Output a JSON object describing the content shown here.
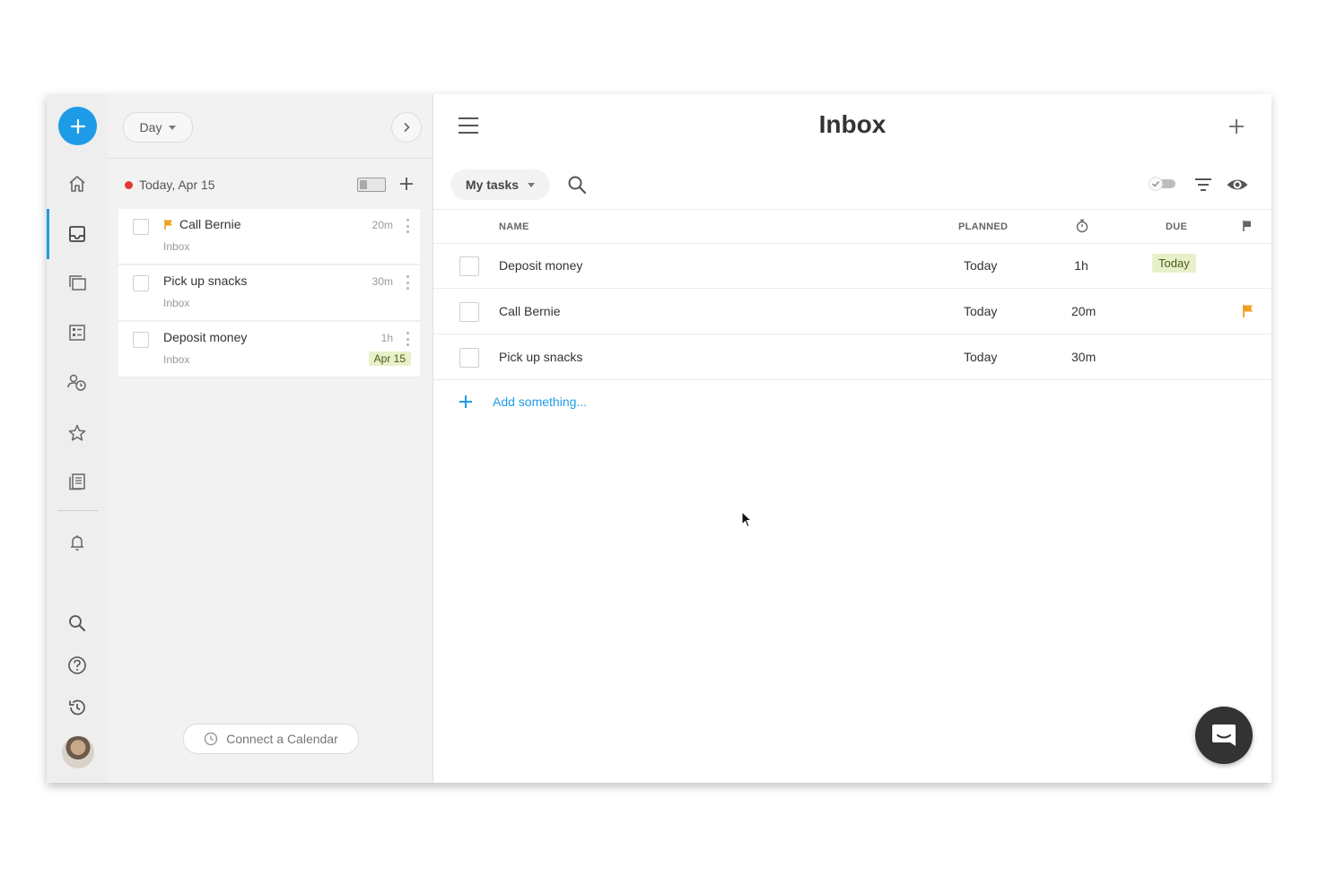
{
  "app": {
    "brand_color": "#1e9be6"
  },
  "rail": {
    "items": [
      {
        "name": "home-icon"
      },
      {
        "name": "inbox-icon",
        "active": true
      },
      {
        "name": "projects-icon"
      },
      {
        "name": "checklist-icon"
      },
      {
        "name": "people-icon"
      },
      {
        "name": "star-icon"
      },
      {
        "name": "notes-icon"
      },
      {
        "name": "bell-icon"
      },
      {
        "name": "search-icon"
      },
      {
        "name": "help-icon"
      },
      {
        "name": "history-icon"
      }
    ]
  },
  "day_panel": {
    "view_selector": "Day",
    "date_label": "Today, Apr 15",
    "tasks": [
      {
        "title": "Call Bernie",
        "list": "Inbox",
        "duration": "20m",
        "flagged": true
      },
      {
        "title": "Pick up snacks",
        "list": "Inbox",
        "duration": "30m"
      },
      {
        "title": "Deposit money",
        "list": "Inbox",
        "duration": "1h",
        "date_chip": "Apr 15"
      }
    ],
    "connect_calendar": "Connect a Calendar"
  },
  "main": {
    "title": "Inbox",
    "filter_label": "My tasks",
    "columns": {
      "name": "NAME",
      "planned": "PLANNED",
      "due": "DUE"
    },
    "rows": [
      {
        "name": "Deposit money",
        "planned": "Today",
        "duration": "1h",
        "due": "Today",
        "flag": false
      },
      {
        "name": "Call Bernie",
        "planned": "Today",
        "duration": "20m",
        "due": "",
        "flag": true
      },
      {
        "name": "Pick up snacks",
        "planned": "Today",
        "duration": "30m",
        "due": "",
        "flag": false
      }
    ],
    "add_label": "Add something...",
    "flag_color": "#f0a01e",
    "due_chip_color": "#e8f0c9"
  }
}
